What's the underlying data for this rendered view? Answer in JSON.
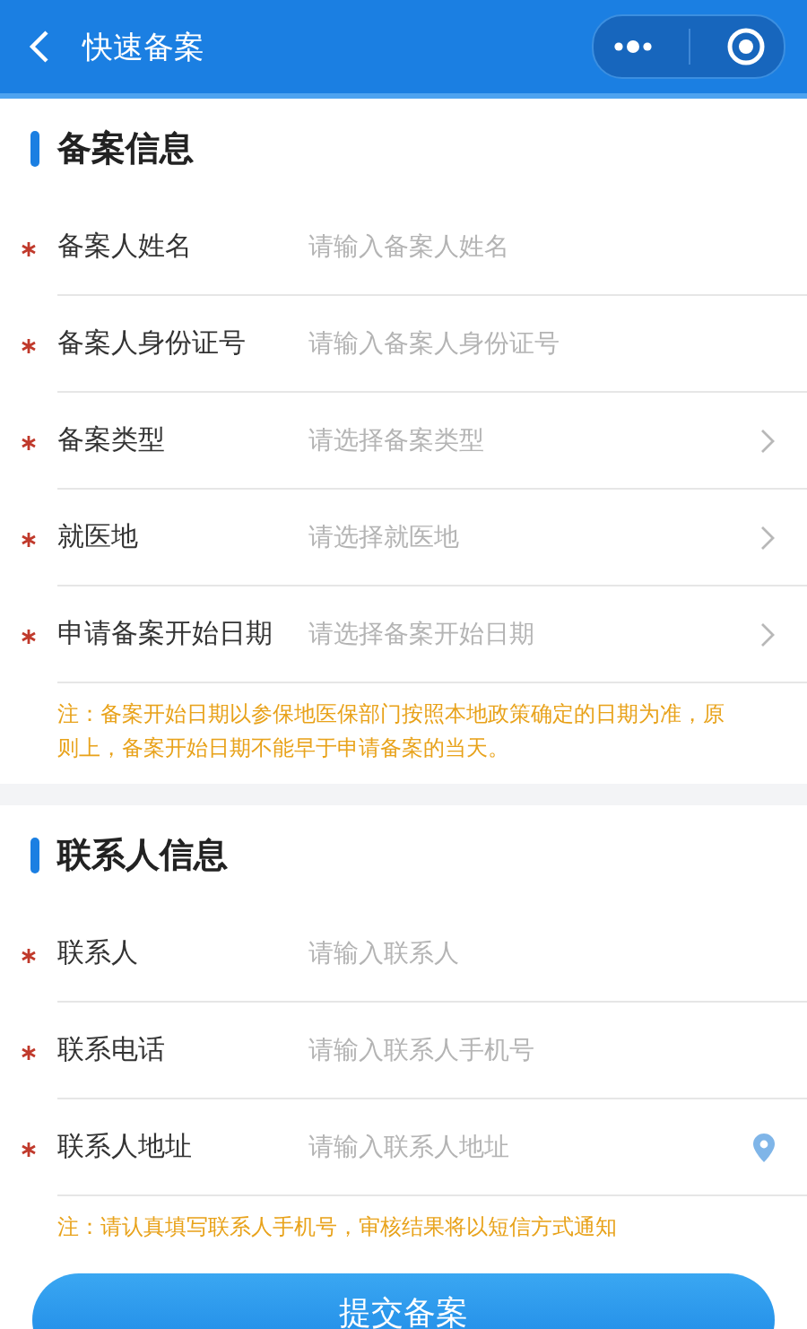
{
  "header": {
    "title": "快速备案"
  },
  "sections": [
    {
      "title": "备案信息",
      "fields": [
        {
          "label": "备案人姓名",
          "placeholder": "请输入备案人姓名",
          "kind": "input",
          "required": true
        },
        {
          "label": "备案人身份证号",
          "placeholder": "请输入备案人身份证号",
          "kind": "input",
          "required": true
        },
        {
          "label": "备案类型",
          "placeholder": "请选择备案类型",
          "kind": "select",
          "required": true
        },
        {
          "label": "就医地",
          "placeholder": "请选择就医地",
          "kind": "select",
          "required": true
        },
        {
          "label": "申请备案开始日期",
          "placeholder": "请选择备案开始日期",
          "kind": "select",
          "required": true
        }
      ],
      "note": "注：备案开始日期以参保地医保部门按照本地政策确定的日期为准，原则上，备案开始日期不能早于申请备案的当天。"
    },
    {
      "title": "联系人信息",
      "fields": [
        {
          "label": "联系人",
          "placeholder": "请输入联系人",
          "kind": "input",
          "required": true
        },
        {
          "label": "联系电话",
          "placeholder": "请输入联系人手机号",
          "kind": "input",
          "required": true
        },
        {
          "label": "联系人地址",
          "placeholder": "请输入联系人地址",
          "kind": "location",
          "required": true
        }
      ],
      "note": "注：请认真填写联系人手机号，审核结果将以短信方式通知"
    }
  ],
  "submit": "提交备案"
}
